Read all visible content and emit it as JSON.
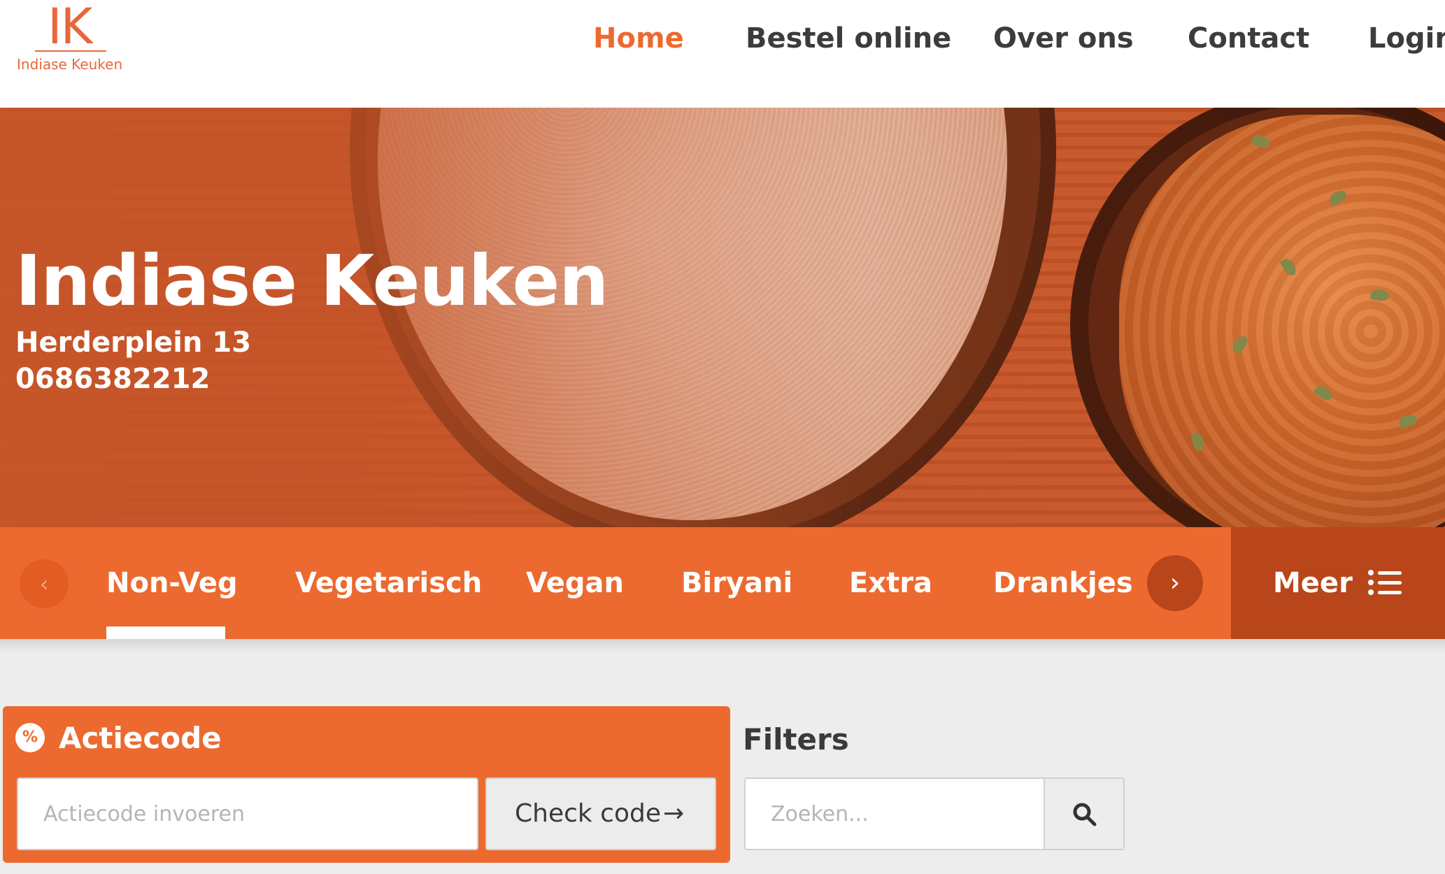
{
  "logo": {
    "mark": "IK",
    "name": "Indiase Keuken"
  },
  "nav": [
    {
      "label": "Home",
      "active": true
    },
    {
      "label": "Bestel online",
      "active": false
    },
    {
      "label": "Over ons",
      "active": false
    },
    {
      "label": "Contact",
      "active": false
    },
    {
      "label": "Login",
      "active": false
    }
  ],
  "hero": {
    "title": "Indiase Keuken",
    "address": "Herderplein 13",
    "phone": "0686382212"
  },
  "categories": {
    "prev_icon": "chevron-left-icon",
    "next_icon": "chevron-right-icon",
    "items": [
      "Non-Veg",
      "Vegetarisch",
      "Vegan",
      "Biryani",
      "Extra",
      "Drankjes"
    ],
    "active": "Non-Veg",
    "more_label": "Meer",
    "more_icon": "list-icon"
  },
  "action": {
    "icon": "percent-badge-icon",
    "title": "Actiecode",
    "input_placeholder": "Actiecode invoeren",
    "button_label": "Check code",
    "button_icon": "arrow-right-icon"
  },
  "filters": {
    "title": "Filters",
    "search_placeholder": "Zoeken...",
    "search_icon": "search-icon"
  },
  "colors": {
    "accent": "#ec6a30",
    "accent_dark": "#b9461b",
    "text_dark": "#3a3a3a",
    "background": "#ededed"
  }
}
